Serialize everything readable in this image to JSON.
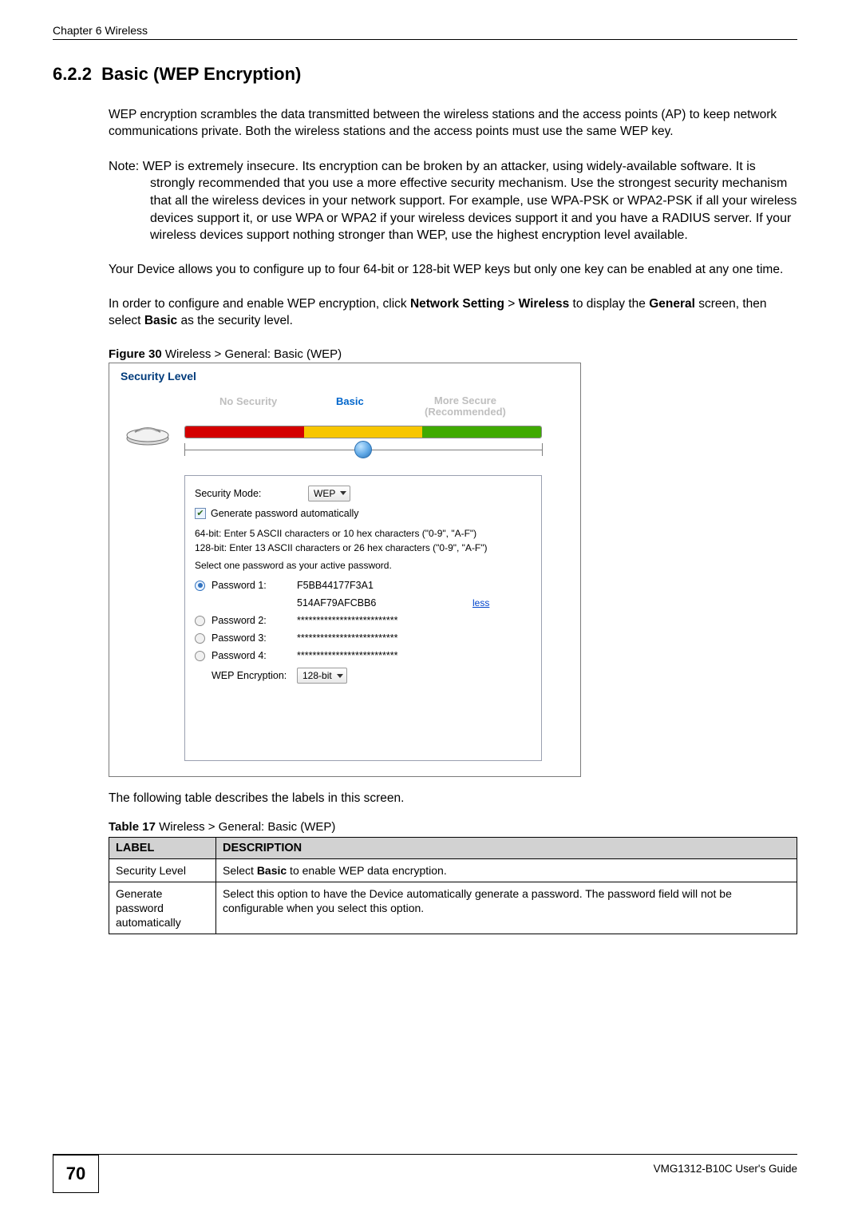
{
  "header": {
    "chapter": "Chapter 6 Wireless"
  },
  "section": {
    "number": "6.2.2",
    "title": "Basic (WEP Encryption)"
  },
  "paragraphs": {
    "p1": "WEP encryption scrambles the data transmitted between the wireless stations and the access points (AP) to keep network communications private. Both the wireless stations and the access points must use the same WEP key.",
    "note": "Note: WEP is extremely insecure. Its encryption can be broken by an attacker, using widely-available software. It is strongly recommended that you use a more effective security mechanism. Use the strongest security mechanism that all the wireless devices in your network support. For example, use WPA-PSK or WPA2-PSK if all your wireless devices support it, or use WPA or WPA2 if your wireless devices support it and you have a RADIUS server. If your wireless devices support nothing stronger than WEP, use the highest encryption level available.",
    "p2": "Your Device allows you to configure up to four 64-bit or 128-bit WEP keys but only one key can be enabled at any one time.",
    "p3a": "In order to configure and enable WEP encryption, click ",
    "p3_bold1": "Network Setting",
    "p3_gt": " > ",
    "p3_bold2": "Wireless",
    "p3b": " to display the ",
    "p3_bold3": "General",
    "p3c": " screen, then select ",
    "p3_bold4": "Basic",
    "p3d": " as the security level."
  },
  "figure": {
    "label": "Figure 30",
    "caption": "   Wireless > General: Basic (WEP)"
  },
  "screenshot": {
    "section_title": "Security Level",
    "slider": {
      "no_security": "No Security",
      "basic": "Basic",
      "more_secure_l1": "More Secure",
      "more_secure_l2": "(Recommended)"
    },
    "panel": {
      "security_mode_label": "Security Mode:",
      "security_mode_value": "WEP",
      "gen_auto_label": "Generate password automatically",
      "hint1": "64-bit: Enter 5 ASCII characters or 10 hex characters (\"0-9\", \"A-F\")",
      "hint2": "128-bit: Enter 13 ASCII characters or 26 hex characters (\"0-9\", \"A-F\")",
      "hint3": "Select one password as your active password.",
      "passwords": [
        {
          "label": "Password 1:",
          "value_line1": "F5BB44177F3A1",
          "value_line2": "514AF79AFCBB6",
          "less": "less",
          "selected": true
        },
        {
          "label": "Password 2:",
          "value": "**************************",
          "selected": false
        },
        {
          "label": "Password 3:",
          "value": "**************************",
          "selected": false
        },
        {
          "label": "Password 4:",
          "value": "**************************",
          "selected": false
        }
      ],
      "wep_enc_label": "WEP Encryption:",
      "wep_enc_value": "128-bit"
    }
  },
  "table_intro": "The following table describes the labels in this screen.",
  "table": {
    "label": "Table 17",
    "caption": "   Wireless > General: Basic (WEP)",
    "headers": {
      "c1": "LABEL",
      "c2": "DESCRIPTION"
    },
    "rows": [
      {
        "label": "Security Level",
        "desc_a": "Select ",
        "desc_bold": "Basic",
        "desc_b": " to enable WEP data encryption."
      },
      {
        "label": "Generate password automatically",
        "desc": "Select this option to have the Device automatically generate a password. The password field will not be configurable when you select this option."
      }
    ]
  },
  "footer": {
    "page": "70",
    "guide": "VMG1312-B10C User's Guide"
  }
}
